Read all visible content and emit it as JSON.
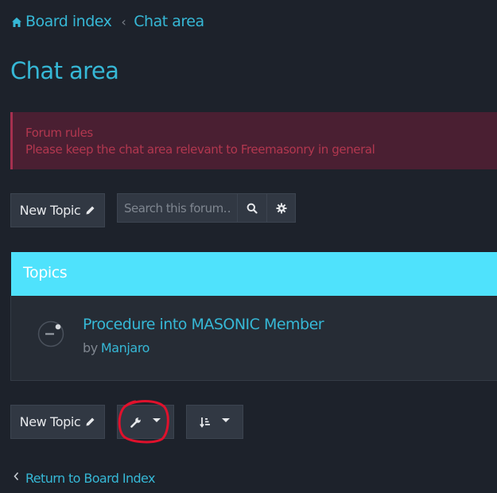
{
  "breadcrumb": {
    "home_label": "Board index",
    "current_label": "Chat area",
    "home_icon": "home-icon",
    "separator_icon": "chevron-left-icon"
  },
  "page": {
    "title": "Chat area"
  },
  "rules": {
    "heading": "Forum rules",
    "text": "Please keep the chat area relevant to Freemasonry in general"
  },
  "actions": {
    "new_topic_label": "New Topic",
    "new_topic_icon": "pencil-icon",
    "search_placeholder": "Search this forum…",
    "search_icon": "search-icon",
    "advanced_search_icon": "gear-icon",
    "tools_icon": "wrench-icon",
    "sort_icon": "sort-icon"
  },
  "topics": {
    "header": "Topics",
    "items": [
      {
        "title": "Procedure into MASONIC Member",
        "by_label": "by",
        "author": "Manjaro",
        "status_icon": "topic-read-icon"
      }
    ]
  },
  "footer": {
    "return_label": "Return to Board Index"
  },
  "colors": {
    "background": "#1d222b",
    "accent": "#36b8d6",
    "topics_header": "#4fe2fc",
    "rules_background": "#4a1f32",
    "rules_text": "#b2374f",
    "annotation": "#e0112c"
  }
}
